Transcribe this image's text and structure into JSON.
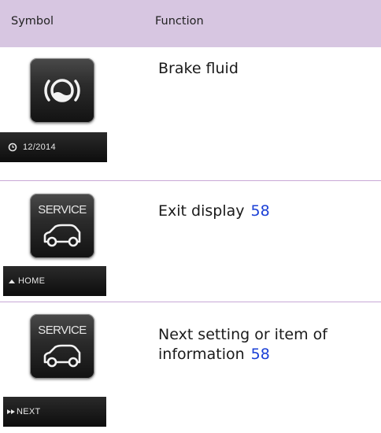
{
  "header": {
    "symbol_label": "Symbol",
    "function_label": "Function"
  },
  "rows": [
    {
      "function_text": "Brake fluid",
      "date_text": "12/2014",
      "icon": "brake-fluid-icon"
    },
    {
      "function_text": "Exit display",
      "ref": "58",
      "tile_label": "SERVICE",
      "bar_text": "HOME",
      "icon": "car-icon"
    },
    {
      "function_text_1": "Next setting or item of",
      "function_text_2": "information",
      "ref": "58",
      "tile_label": "SERVICE",
      "bar_text": "NEXT",
      "icon": "car-icon"
    }
  ]
}
